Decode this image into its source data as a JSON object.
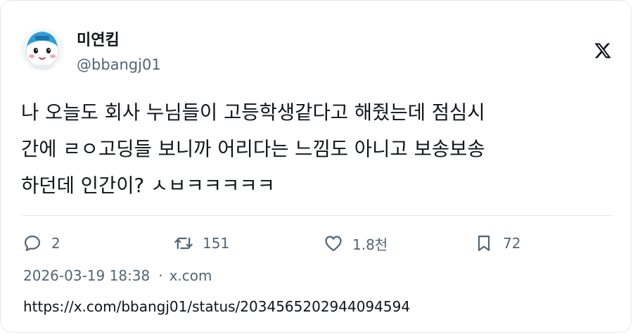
{
  "author": {
    "display_name": "미연킴",
    "handle": "@bbangj01"
  },
  "brand_logo": "x-logo",
  "tweet": {
    "lines": [
      "나 오늘도 회사 누님들이 고등학생같다고 해줬는데 점심시",
      "간에 ㄹㅇ고딩들 보니까 어리다는 느낌도 아니고 보송보송",
      "하던데 인간이? ㅅㅂㅋㅋㅋㅋㅋ"
    ]
  },
  "actions": {
    "reply": {
      "icon": "reply-icon",
      "count": "2"
    },
    "repost": {
      "icon": "repost-icon",
      "count": "151"
    },
    "like": {
      "icon": "heart-icon",
      "count": "1.8천"
    },
    "bookmark": {
      "icon": "bookmark-icon",
      "count": "72"
    }
  },
  "meta": {
    "timestamp": "2026-03-19 18:38",
    "separator": "·",
    "source": "x.com"
  },
  "url": "https://x.com/bbangj01/status/2034565202944094594",
  "colors": {
    "text_primary": "#0f1419",
    "text_secondary": "#536471",
    "border": "#e6e8eb",
    "avatar_hat": "#2f9fd6"
  }
}
